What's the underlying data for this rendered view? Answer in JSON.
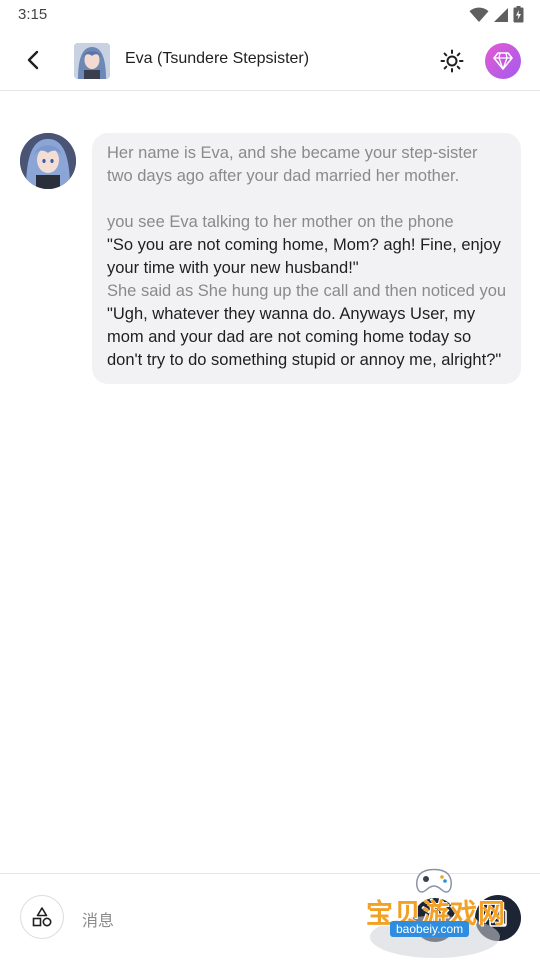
{
  "status_bar": {
    "time": "3:15",
    "icons": [
      "wifi-icon",
      "cellular-signal-icon",
      "battery-charging-icon"
    ]
  },
  "header": {
    "back_icon": "chevron-left-icon",
    "title": "Eva (Tsundere Stepsister)",
    "theme_icon": "sun-icon",
    "premium_icon": "diamond-icon"
  },
  "conversation": {
    "messages": [
      {
        "sender": "Eva",
        "paragraphs": [
          {
            "style": "narration",
            "text": "Her name is Eva, and she became your step-sister two days ago after your dad married her mother."
          },
          {
            "style": "narration",
            "text": "you see Eva talking to her mother on the phone"
          },
          {
            "style": "speech",
            "text": "\"So you are not coming home, Mom? agh! Fine, enjoy your time with your new husband!\""
          },
          {
            "style": "narration",
            "text": "She said as She hung up the call and then noticed you"
          },
          {
            "style": "speech",
            "text": "\"Ugh, whatever they wanna do. Anyways User, my mom and your dad are not coming home today so don't try to do something stupid or annoy me, alright?\""
          }
        ]
      }
    ]
  },
  "composer": {
    "tools_icon": "shapes-icon",
    "placeholder": "消息",
    "image_icon": "image-icon"
  },
  "watermark": {
    "title": "宝贝游戏网",
    "url": "baobeiy.com"
  },
  "colors": {
    "bubble_bg": "#f2f2f4",
    "narration_text": "#8a8a8a",
    "speech_text": "#1f1f1f",
    "premium_gradient_start": "#e45bd0",
    "premium_gradient_end": "#a35bf0",
    "dark_button": "#1d2433"
  }
}
